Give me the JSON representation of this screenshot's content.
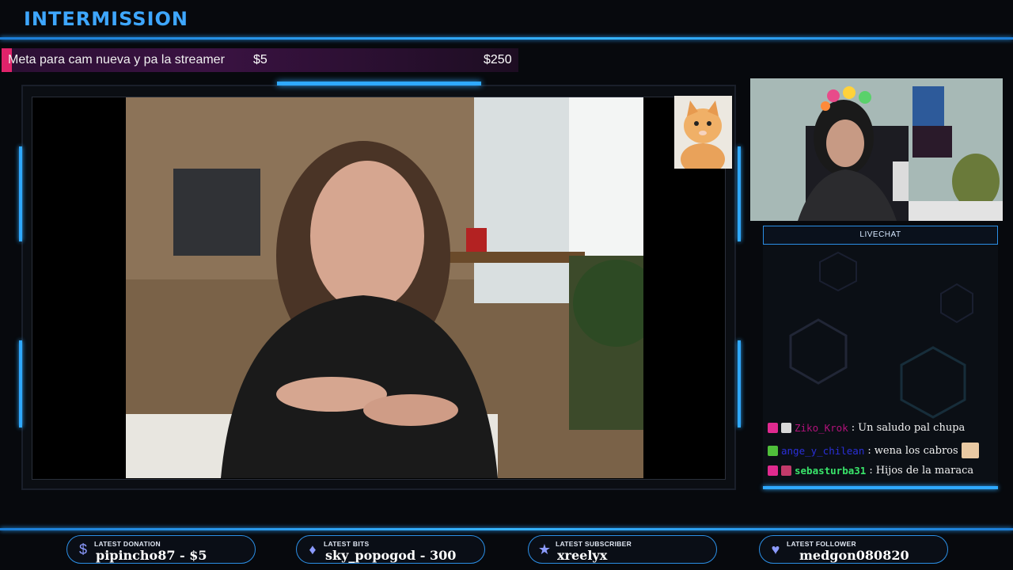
{
  "header": {
    "title": "INTERMISSION"
  },
  "goal": {
    "label": "Meta para cam nueva y pa la streamer",
    "current": "$5",
    "target": "$250",
    "progress": 0.02
  },
  "chat": {
    "title": "LIVECHAT",
    "messages": [
      {
        "user": "Ziko_Krok",
        "sep": ":",
        "text": "Un saludo pal chupa",
        "user_color": "#b1127a"
      },
      {
        "user": "ange_y_chilean",
        "sep": ":",
        "text": "wena los cabros",
        "user_color": "#2a2fd8"
      },
      {
        "user": "sebasturba31",
        "sep": ":",
        "text": "Hijos de la maraca",
        "user_color": "#39e56a"
      }
    ]
  },
  "footer": {
    "donation": {
      "label": "LATEST DONATION",
      "value": "pipincho87 - $5",
      "icon": "dollar-icon"
    },
    "bits": {
      "label": "LATEST BITS",
      "value": "sky_popogod - 300",
      "icon": "diamond-icon"
    },
    "subscriber": {
      "label": "LATEST SUBSCRIBER",
      "value": "xreelyx",
      "icon": "star-icon"
    },
    "follower": {
      "label": "LATEST FOLLOWER",
      "value": "medgon080820",
      "icon": "heart-icon"
    }
  },
  "colors": {
    "accent": "#2fa9ff",
    "title": "#3ea7ff",
    "goal_fill": "#e0236a"
  }
}
